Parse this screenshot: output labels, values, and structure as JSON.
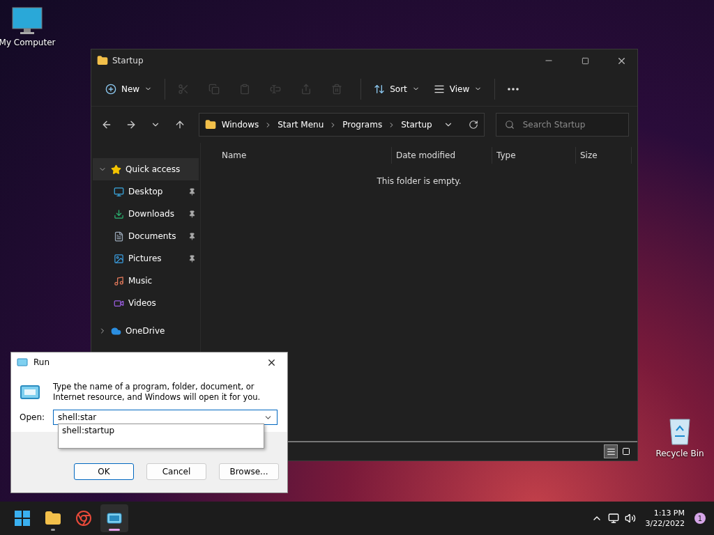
{
  "desktop_icons": [
    {
      "kind": "computer",
      "label": "My Computer"
    },
    {
      "kind": "recycle",
      "label": "Recycle Bin"
    }
  ],
  "explorer": {
    "title": "Startup",
    "toolbar": [
      {
        "kind": "new",
        "label": "New",
        "disabled": false
      },
      {
        "kind": "cut",
        "disabled": true
      },
      {
        "kind": "copy",
        "disabled": true
      },
      {
        "kind": "paste",
        "disabled": true
      },
      {
        "kind": "rename",
        "disabled": true
      },
      {
        "kind": "share",
        "disabled": true
      },
      {
        "kind": "delete",
        "disabled": true
      },
      {
        "kind": "sort",
        "label": "Sort",
        "disabled": false
      },
      {
        "kind": "view",
        "label": "View",
        "disabled": false
      },
      {
        "kind": "more",
        "disabled": false
      }
    ],
    "breadcrumbs": [
      "Windows",
      "Start Menu",
      "Programs",
      "Startup"
    ],
    "search": {
      "placeholder": "Search Startup"
    },
    "sidebar": [
      {
        "kind": "star",
        "label": "Quick access",
        "expanded": true,
        "selected": true,
        "children": [
          {
            "kind": "desktop",
            "label": "Desktop",
            "pinned": true,
            "selected": false
          },
          {
            "kind": "downloads",
            "label": "Downloads",
            "pinned": true,
            "selected": false
          },
          {
            "kind": "documents",
            "label": "Documents",
            "pinned": true,
            "selected": false
          },
          {
            "kind": "pictures",
            "label": "Pictures",
            "pinned": true,
            "selected": false
          },
          {
            "kind": "music",
            "label": "Music",
            "pinned": false,
            "selected": false
          },
          {
            "kind": "videos",
            "label": "Videos",
            "pinned": false,
            "selected": false
          }
        ]
      },
      {
        "kind": "cloud",
        "label": "OneDrive",
        "expanded": false,
        "selected": false
      }
    ],
    "columns": [
      "Name",
      "Date modified",
      "Type",
      "Size"
    ],
    "empty_message": "This folder is empty.",
    "view_buttons": [
      {
        "kind": "details",
        "selected": true
      },
      {
        "kind": "tiles",
        "selected": false
      }
    ]
  },
  "run_dialog": {
    "title": "Run",
    "description": "Type the name of a program, folder, document, or Internet resource, and Windows will open it for you.",
    "open_label": "Open:",
    "value": "shell:star",
    "suggestions": [
      "shell:startup"
    ],
    "buttons": [
      {
        "label": "OK",
        "default": true
      },
      {
        "label": "Cancel",
        "default": false
      },
      {
        "label": "Browse...",
        "default": false
      }
    ]
  },
  "taskbar": {
    "apps": [
      {
        "kind": "start",
        "running": false,
        "active": false
      },
      {
        "kind": "explorer",
        "running": true,
        "active": false
      },
      {
        "kind": "chrome",
        "running": false,
        "active": false
      },
      {
        "kind": "run",
        "running": true,
        "active": true
      }
    ],
    "time": "1:13 PM",
    "date": "3/22/2022",
    "notifications": "1"
  }
}
